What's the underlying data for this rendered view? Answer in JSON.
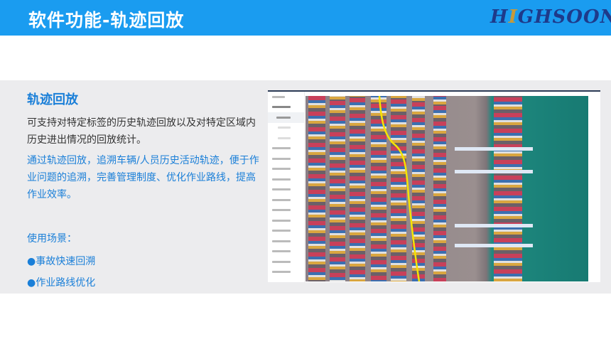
{
  "header": {
    "title": "软件功能-轨迹回放",
    "logo": "HIGHSOON"
  },
  "content": {
    "subtitle": "轨迹回放",
    "para1": "可支持对特定标签的历史轨迹回放以及对特定区域内历史进出情况的回放统计。",
    "para2": "通过轨迹回放，追溯车辆/人员历史活动轨迹，便于作业问题的追溯，完善管理制度、优化作业路线，提高作业效率。",
    "scenes_label": "使用场景：",
    "scenes": [
      "●事故快速回溯",
      "●作业路线优化"
    ]
  },
  "colors": {
    "header": "#1a9cf0",
    "accent": "#1a7fd8",
    "track": "#f5e400"
  }
}
